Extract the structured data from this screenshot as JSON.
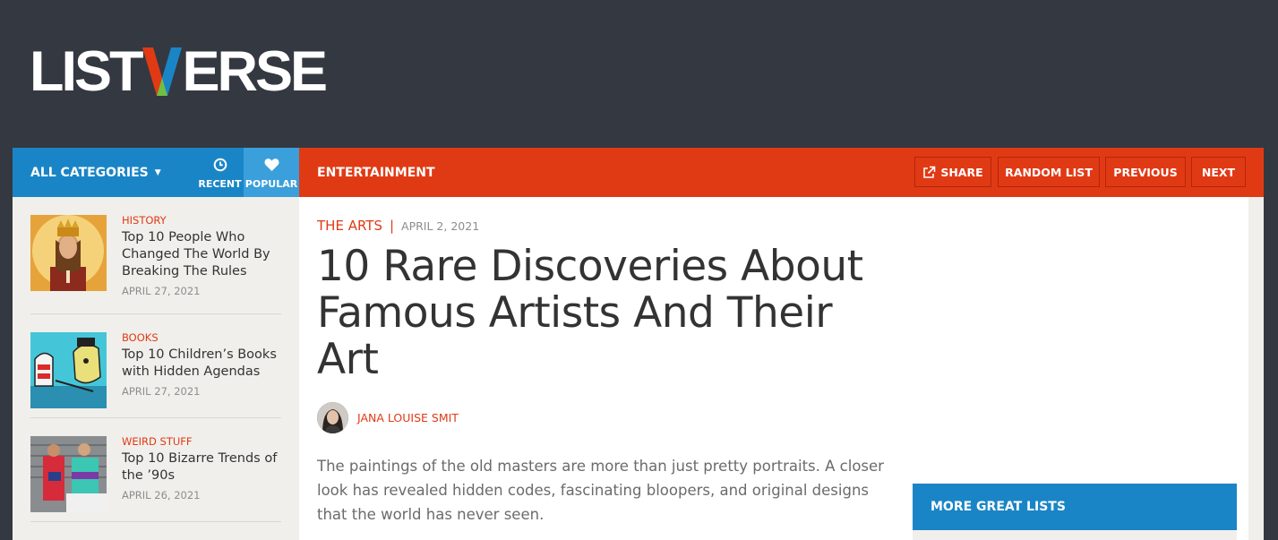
{
  "site": {
    "logo_text_left": "LIST",
    "logo_text_right": "ERSE",
    "colors": {
      "header_bg": "#343841",
      "nav_blue": "#1a85c6",
      "nav_orange": "#e03a15",
      "popular_blue": "#3a9fdb"
    }
  },
  "nav": {
    "categories_label": "ALL CATEGORIES",
    "recent_label": "RECENT",
    "recent_icon": "clock-icon",
    "popular_label": "POPULAR",
    "popular_icon": "heart-icon",
    "section_title": "ENTERTAINMENT",
    "share_label": "SHARE",
    "share_icon": "external-link-icon",
    "random_label": "RANDOM LIST",
    "previous_label": "PREVIOUS",
    "next_label": "NEXT"
  },
  "sidebar": {
    "items": [
      {
        "category": "HISTORY",
        "title": "Top 10 People Who Changed The World By Breaking The Rules",
        "date": "APRIL 27, 2021"
      },
      {
        "category": "BOOKS",
        "title": "Top 10 Children’s Books with Hidden Agendas",
        "date": "APRIL 27, 2021"
      },
      {
        "category": "WEIRD STUFF",
        "title": "Top 10 Bizarre Trends of the ’90s",
        "date": "APRIL 26, 2021"
      }
    ]
  },
  "article": {
    "category": "THE ARTS",
    "separator": "|",
    "date": "APRIL 2, 2021",
    "title": "10 Rare Discoveries About Famous Artists And Their Art",
    "author": "JANA LOUISE SMIT",
    "intro": "The paintings of the old masters are more than just pretty portraits. A closer look has revealed hidden codes, fascinating bloopers, and original designs that the world has never seen."
  },
  "aside": {
    "more_title": "MORE GREAT LISTS"
  }
}
